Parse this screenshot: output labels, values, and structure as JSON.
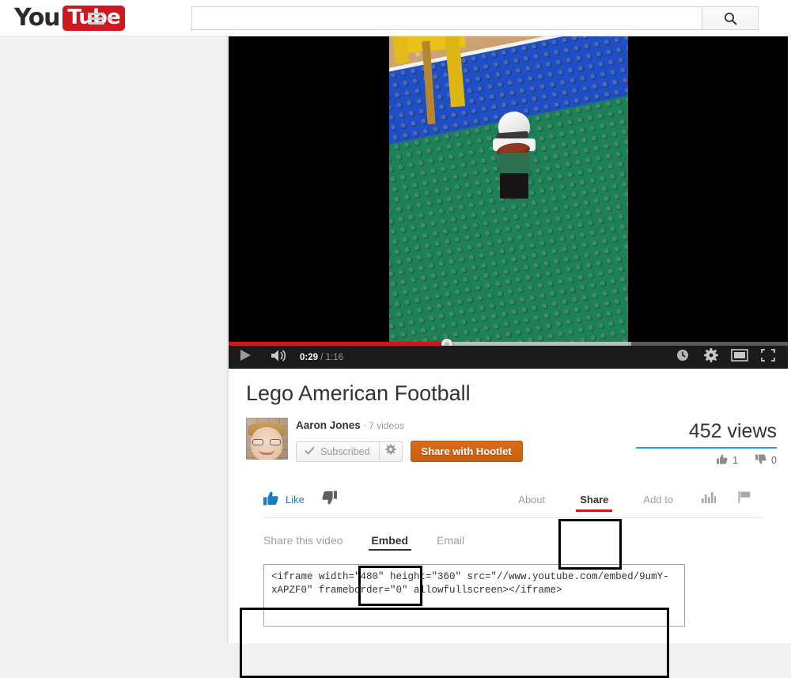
{
  "masthead": {
    "logo_you": "You",
    "logo_tube": "Tube",
    "guide_icon": "hamburger-menu-icon",
    "guide_caret_icon": "chevron-down-icon",
    "search": {
      "value": "",
      "placeholder": "",
      "button_icon": "search-icon"
    }
  },
  "player": {
    "play_icon": "play-icon",
    "volume_icon": "volume-icon",
    "current_time": "0:29",
    "time_separator": "/",
    "total_time": "1:16",
    "progress_percent": 39,
    "loaded_percent": 72,
    "right_icons": [
      {
        "name": "watch-later-icon",
        "label": "Watch later"
      },
      {
        "name": "settings-gear-icon",
        "label": "Settings"
      },
      {
        "name": "theater-mode-icon",
        "label": "Theater mode"
      },
      {
        "name": "fullscreen-icon",
        "label": "Fullscreen"
      }
    ]
  },
  "video": {
    "title": "Lego American Football",
    "uploader": "Aaron Jones",
    "dot": "·",
    "video_count": "7 videos",
    "subscribe_label": "Subscribed",
    "subscribe_check_icon": "check-icon",
    "subscribe_gear_icon": "gear-icon",
    "hootlet_label": "Share with Hootlet",
    "views": "452 views",
    "likes": "1",
    "dislikes": "0",
    "like_icon": "thumbs-up-icon",
    "dislike_icon": "thumbs-down-icon"
  },
  "actionbar": {
    "like_label": "Like",
    "like_icon": "thumbs-up-icon",
    "dislike_icon": "thumbs-down-icon",
    "items": [
      {
        "label": "About",
        "active": false
      },
      {
        "label": "Share",
        "active": true
      },
      {
        "label": "Add to",
        "active": false
      }
    ],
    "stats_icon": "statistics-bar-icon",
    "flag_icon": "flag-icon"
  },
  "share_panel": {
    "tabs": [
      {
        "label": "Share this video",
        "active": false
      },
      {
        "label": "Embed",
        "active": true
      },
      {
        "label": "Email",
        "active": false
      }
    ],
    "embed_code": "<iframe width=\"480\" height=\"360\" src=\"//www.youtube.com/embed/9umY-xAPZF0\" frameborder=\"0\" allowfullscreen></iframe>"
  },
  "colors": {
    "brand_red": "#cc181e",
    "link_blue": "#167ac6",
    "sentiment_blue": "#3498db",
    "hootlet_orange": "#c75f12",
    "page_bg": "#f1f1f1",
    "annotation": "#000000"
  }
}
